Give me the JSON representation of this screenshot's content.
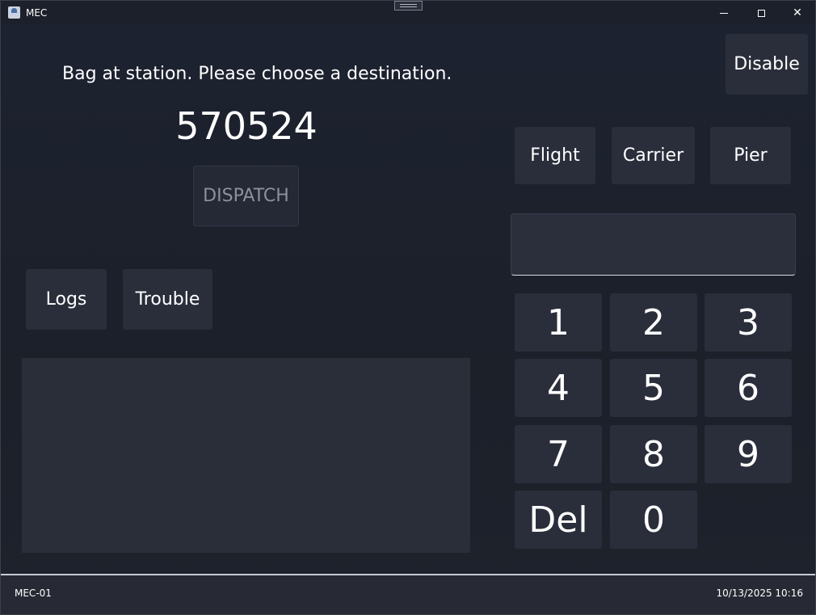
{
  "window": {
    "title": "MEC",
    "controls": {
      "minimize": "minimize",
      "maximize": "maximize",
      "close": "✕"
    }
  },
  "main": {
    "prompt": "Bag at station. Please choose a destination.",
    "bag_number": "570524",
    "dispatch_label": "DISPATCH",
    "logs_label": "Logs",
    "trouble_label": "Trouble"
  },
  "right_panel": {
    "disable_label": "Disable",
    "destination_types": [
      "Flight",
      "Carrier",
      "Pier"
    ],
    "entry_value": "",
    "keypad": {
      "k1": "1",
      "k2": "2",
      "k3": "3",
      "k4": "4",
      "k5": "5",
      "k6": "6",
      "k7": "7",
      "k8": "8",
      "k9": "9",
      "del": "Del",
      "k0": "0"
    }
  },
  "status_bar": {
    "station_id": "MEC-01",
    "datetime": "10/13/2025 10:16"
  },
  "colors": {
    "background": "#1b1f2b",
    "button": "#2a2e3b",
    "button_disabled_text": "#8c909c",
    "text": "#ffffff"
  },
  "icons": [
    "app-icon",
    "minimize-icon",
    "maximize-icon",
    "close-icon",
    "drag-handle-icon"
  ]
}
